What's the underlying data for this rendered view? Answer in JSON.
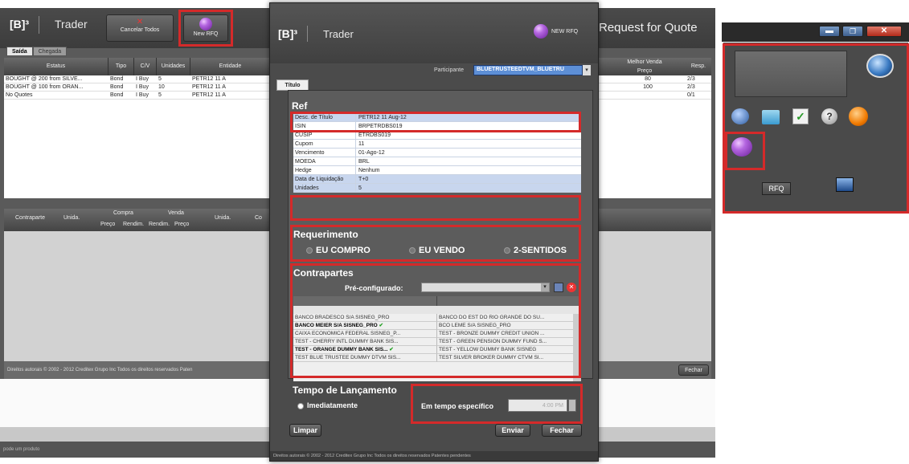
{
  "background_window": {
    "logo": "[B]³",
    "app_name": "Trader",
    "cancel_all_label": "Cancelar Todos",
    "new_rfq_label": "New RFQ",
    "request_for_quote_title": "Request for Quote",
    "tabs": [
      {
        "label": "Saída"
      },
      {
        "label": "Chegada"
      }
    ],
    "table_headers": [
      "Estatus",
      "Tipo",
      "C/V",
      "Unidades",
      "Entidade"
    ],
    "right_headers": {
      "best_sell": "Melhor Venda",
      "price": "Preço",
      "resp": "Resp."
    },
    "rows": [
      {
        "status": "BOUGHT @ 200 from SILVE...",
        "tipo": "Bond",
        "cv": "I Buy",
        "unidades": "5",
        "entidade": "PETR12 11 A",
        "preco": "80",
        "resp": "2/3"
      },
      {
        "status": "BOUGHT @ 100 from ORAN...",
        "tipo": "Bond",
        "cv": "I Buy",
        "unidades": "10",
        "entidade": "PETR12 11 A",
        "preco": "100",
        "resp": "2/3"
      },
      {
        "status": "No Quotes",
        "tipo": "Bond",
        "cv": "I Buy",
        "unidades": "5",
        "entidade": "PETR12 11 A",
        "preco": "",
        "resp": "0/1"
      }
    ],
    "lower_headers": {
      "contraparte": "Contraparte",
      "unida": "Unida.",
      "compra": "Compra",
      "venda": "Venda",
      "preco": "Preço",
      "rendim": "Rendim.",
      "unida2": "Unida.",
      "co": "Co"
    },
    "footer": "Direitos autorais © 2002 - 2012 Creditex Grupo Inc Todos os direitos reservados Paten",
    "fechar_label": "Fechar",
    "status_bar": "pode um produto"
  },
  "rfq_dialog": {
    "logo": "[B]³",
    "app_name": "Trader",
    "new_rfq_label": "NEW RFQ",
    "participant_label": "Participante",
    "participant_value": "BLUETRUSTEEDTVM_BLUETRU",
    "tab_label": "Título",
    "ref_title": "Ref",
    "ref_fields": [
      {
        "key": "Desc. de Título",
        "value": "PETR12 11 Aug-12"
      },
      {
        "key": "ISIN",
        "value": "BRPETRDBS019"
      },
      {
        "key": "CUSIP",
        "value": "ETRDBS019"
      },
      {
        "key": "Cupom",
        "value": "11"
      },
      {
        "key": "Vencimento",
        "value": "01-Ago-12"
      },
      {
        "key": "MOEDA",
        "value": "BRL"
      },
      {
        "key": "Hedge",
        "value": "Nenhum"
      },
      {
        "key": "Data de Liquidação",
        "value": "T+0"
      },
      {
        "key": "Unidades",
        "value": "5"
      }
    ],
    "requirement_title": "Requerimento",
    "requirement_options": [
      "EU COMPRO",
      "EU VENDO",
      "2-SENTIDOS"
    ],
    "counterparties_title": "Contrapartes",
    "preconfig_label": "Pré-configurado:",
    "counterparties": [
      {
        "left": "BANCO BRADESCO S/A SISNEG_PRO",
        "right": "BANCO DO EST DO RIO GRANDE DO SU...",
        "left_bold": false,
        "left_check": false
      },
      {
        "left": "BANCO MEIER S/A SISNEG_PRO",
        "right": "BCO LEME S/A SISNEG_PRO",
        "left_bold": true,
        "left_check": true
      },
      {
        "left": "CAIXA ECONOMICA FEDERAL SISNEG_P...",
        "right": "TEST - BRONZE DUMMY CREDIT UNION ...",
        "left_bold": false,
        "left_check": false
      },
      {
        "left": "TEST - CHERRY INTL DUMMY BANK SIS...",
        "right": "TEST - GREEN PENSION DUMMY FUND S...",
        "left_bold": false,
        "left_check": false
      },
      {
        "left": "TEST - ORANGE DUMMY BANK SIS...",
        "right": "TEST - YELLOW DUMMY BANK SISNEG",
        "left_bold": true,
        "left_check": true
      },
      {
        "left": "TEST BLUE TRUSTEE DUMMY DTVM SIS...",
        "right": "TEST SILVER BROKER DUMMY CTVM SI...",
        "left_bold": false,
        "left_check": false
      }
    ],
    "launch_title": "Tempo de Lançamento",
    "immediate_label": "Imediatamente",
    "specific_label": "Em tempo específico",
    "time_value": "4:00 PM",
    "clear_label": "Limpar",
    "send_label": "Enviar",
    "close_label": "Fechar",
    "footer": "Direitos autorais © 2002 - 2012 Creditex Grupo Inc Todos os direitos reservados Patentes pendentes"
  },
  "mini_app": {
    "rfq_label": "RFQ"
  },
  "colors": {
    "accent_red": "#d42a2a",
    "selection_blue": "#5d8fd6",
    "orb_purple": "#b466e0"
  }
}
